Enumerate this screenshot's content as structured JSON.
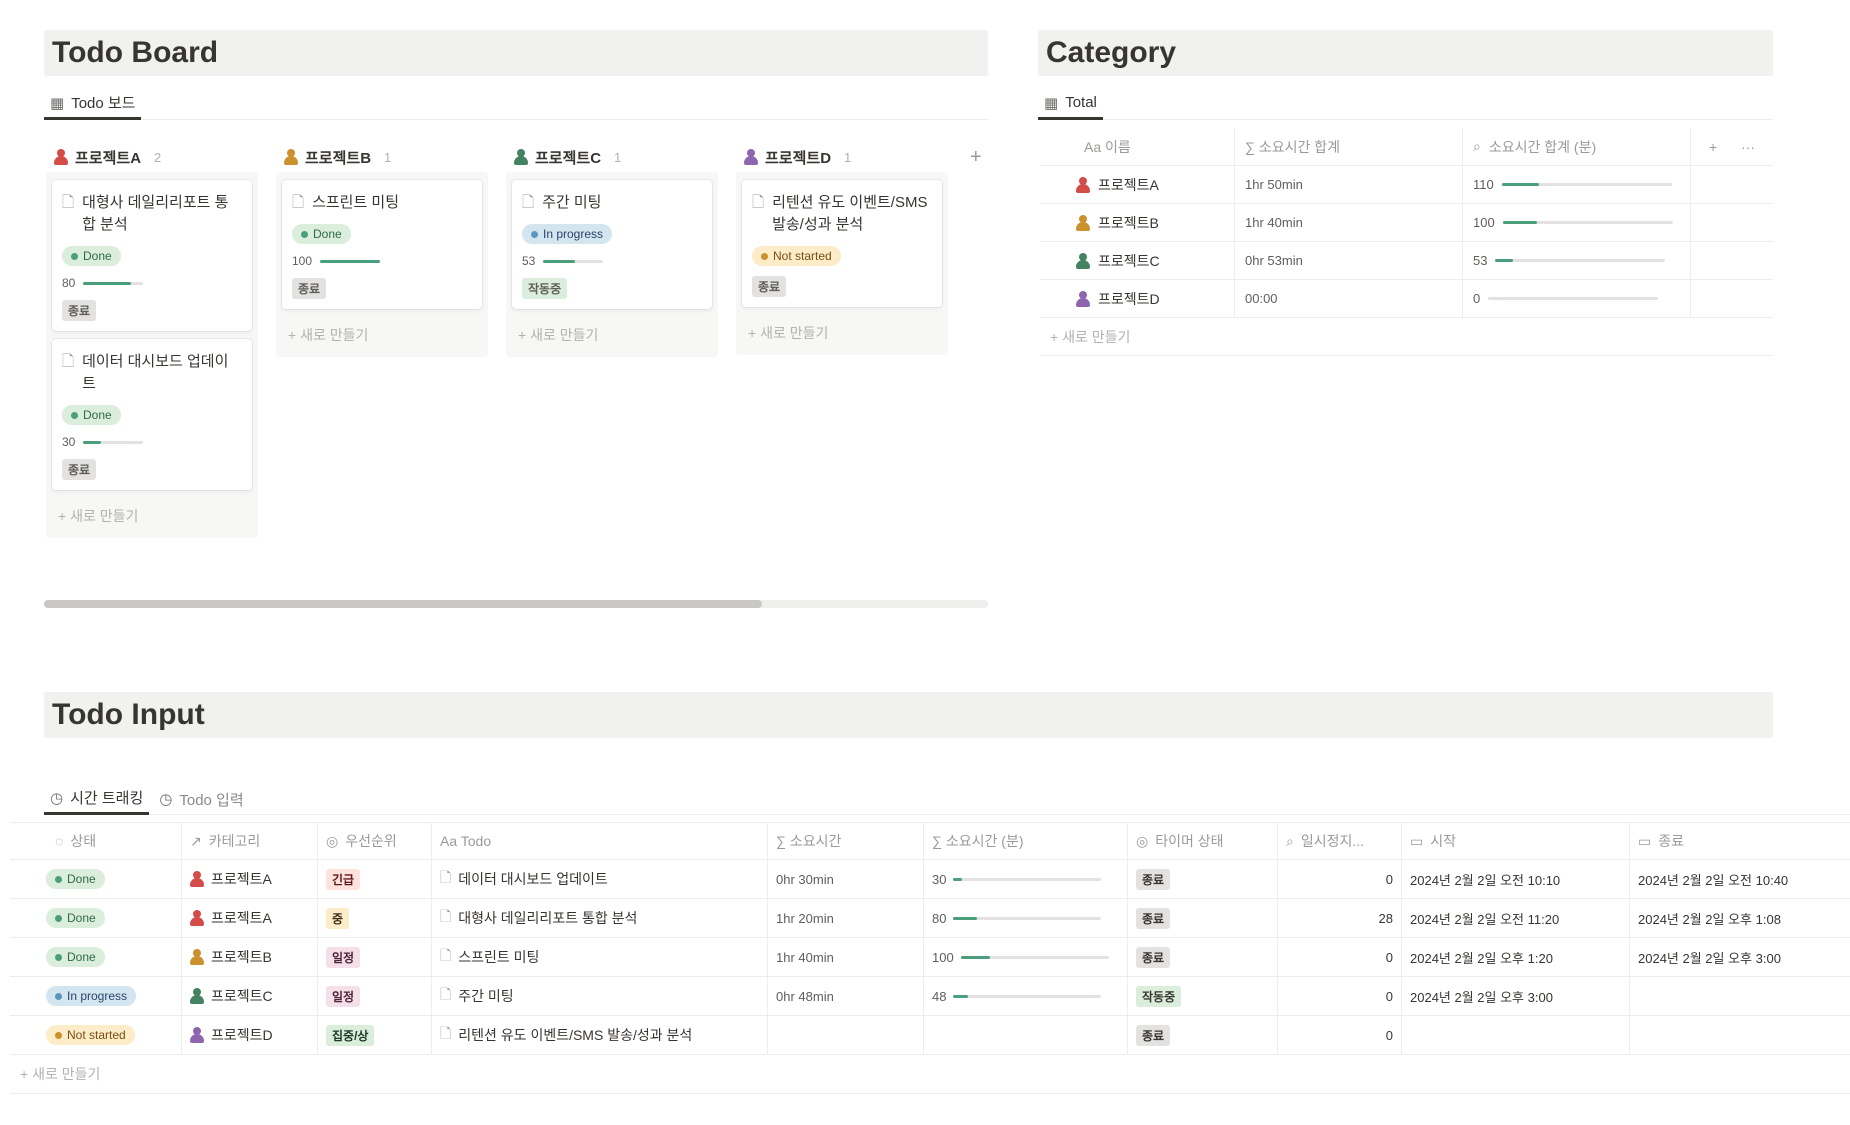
{
  "colors": {
    "project_a": "#d44c47",
    "project_b": "#cb912f",
    "project_c": "#448361",
    "project_d": "#9065b0",
    "progress_fill": "#4a9e7b"
  },
  "todo_board": {
    "title": "Todo Board",
    "tab": "Todo 보드",
    "columns": [
      {
        "name": "프로젝트A",
        "count": "2",
        "color": "#d44c47",
        "cards": [
          {
            "title": "대형사 데일리리포트 통합 분석",
            "status": "Done",
            "status_bg": "#dbeddb",
            "status_fg": "#2e6b48",
            "status_dot": "#4a9e7b",
            "progress_label": "80",
            "progress": 0.8,
            "pill": "종료",
            "pill_bg": "#e3e2e0"
          },
          {
            "title": "데이터 대시보드 업데이트",
            "status": "Done",
            "status_bg": "#dbeddb",
            "status_fg": "#2e6b48",
            "status_dot": "#4a9e7b",
            "progress_label": "30",
            "progress": 0.3,
            "pill": "종료",
            "pill_bg": "#e3e2e0"
          }
        ],
        "new": "+ 새로 만들기"
      },
      {
        "name": "프로젝트B",
        "count": "1",
        "color": "#cb912f",
        "cards": [
          {
            "title": "스프린트 미팅",
            "status": "Done",
            "status_bg": "#dbeddb",
            "status_fg": "#2e6b48",
            "status_dot": "#4a9e7b",
            "progress_label": "100",
            "progress": 1.0,
            "pill": "종료",
            "pill_bg": "#e3e2e0"
          }
        ],
        "new": "+ 새로 만들기"
      },
      {
        "name": "프로젝트C",
        "count": "1",
        "color": "#448361",
        "cards": [
          {
            "title": "주간 미팅",
            "status": "In progress",
            "status_bg": "#d3e5ef",
            "status_fg": "#28456c",
            "status_dot": "#5b97bd",
            "progress_label": "53",
            "progress": 0.53,
            "pill": "작동중",
            "pill_bg": "#dbeddb"
          }
        ],
        "new": "+ 새로 만들기"
      },
      {
        "name": "프로젝트D",
        "count": "1",
        "color": "#9065b0",
        "cards": [
          {
            "title": "리텐션 유도 이벤트/SMS 발송/성과 분석",
            "status": "Not started",
            "status_bg": "#fdecc8",
            "status_fg": "#7a4e12",
            "status_dot": "#cb912f",
            "progress_label": "",
            "progress": null,
            "pill": "종료",
            "pill_bg": "#e3e2e0"
          }
        ],
        "new": "+ 새로 만들기"
      }
    ],
    "add_column": "+"
  },
  "category": {
    "title": "Category",
    "tab": "Total",
    "headers": [
      "Aa 이름",
      "∑ 소요시간 합계",
      "소요시간 합계 (분)",
      "+",
      "···"
    ],
    "rows": [
      {
        "name": "프로젝트A",
        "color": "#d44c47",
        "total": "1hr 50min",
        "minutes": "110",
        "fill": 0.22
      },
      {
        "name": "프로젝트B",
        "color": "#cb912f",
        "total": "1hr 40min",
        "minutes": "100",
        "fill": 0.2
      },
      {
        "name": "프로젝트C",
        "color": "#448361",
        "total": "0hr 53min",
        "minutes": "53",
        "fill": 0.106
      },
      {
        "name": "프로젝트D",
        "color": "#9065b0",
        "total": "00:00",
        "minutes": "0",
        "fill": 0
      }
    ],
    "new": "+ 새로 만들기"
  },
  "todo_input": {
    "title": "Todo Input",
    "tabs": [
      "시간 트래킹",
      "Todo 입력"
    ],
    "headers": [
      "상태",
      "카테고리",
      "우선순위",
      "Aa Todo",
      "∑ 소요시간",
      "∑ 소요시간 (분)",
      "타이머 상태",
      "일시정지...",
      "시작",
      "종료"
    ],
    "rows": [
      {
        "status": "Done",
        "status_bg": "#dbeddb",
        "status_fg": "#2e6b48",
        "status_dot": "#4a9e7b",
        "category": "프로젝트A",
        "cat_color": "#d44c47",
        "priority": "긴급",
        "priority_bg": "#ffe2dd",
        "priority_fg": "#5d1715",
        "todo": "데이터 대시보드 업데이트",
        "time": "0hr 30min",
        "minutes": "30",
        "fill": 0.06,
        "timer": "종료",
        "timer_bg": "#e3e2e0",
        "pause": "0",
        "start": "2024년 2월 2일 오전 10:10",
        "end": "2024년 2월 2일 오전 10:40"
      },
      {
        "status": "Done",
        "status_bg": "#dbeddb",
        "status_fg": "#2e6b48",
        "status_dot": "#4a9e7b",
        "category": "프로젝트A",
        "cat_color": "#d44c47",
        "priority": "중",
        "priority_bg": "#fdecc8",
        "priority_fg": "#402c1b",
        "todo": "대형사 데일리리포트 통합 분석",
        "time": "1hr 20min",
        "minutes": "80",
        "fill": 0.16,
        "timer": "종료",
        "timer_bg": "#e3e2e0",
        "pause": "28",
        "start": "2024년 2월 2일 오전 11:20",
        "end": "2024년 2월 2일 오후 1:08"
      },
      {
        "status": "Done",
        "status_bg": "#dbeddb",
        "status_fg": "#2e6b48",
        "status_dot": "#4a9e7b",
        "category": "프로젝트B",
        "cat_color": "#cb912f",
        "priority": "일정",
        "priority_bg": "#f5e0e9",
        "priority_fg": "#4c2337",
        "todo": "스프린트 미팅",
        "time": "1hr 40min",
        "minutes": "100",
        "fill": 0.2,
        "timer": "종료",
        "timer_bg": "#e3e2e0",
        "pause": "0",
        "start": "2024년 2월 2일 오후 1:20",
        "end": "2024년 2월 2일 오후 3:00"
      },
      {
        "status": "In progress",
        "status_bg": "#d3e5ef",
        "status_fg": "#28456c",
        "status_dot": "#5b97bd",
        "category": "프로젝트C",
        "cat_color": "#448361",
        "priority": "일정",
        "priority_bg": "#f5e0e9",
        "priority_fg": "#4c2337",
        "todo": "주간 미팅",
        "time": "0hr 48min",
        "minutes": "48",
        "fill": 0.096,
        "timer": "작동중",
        "timer_bg": "#dbeddb",
        "pause": "0",
        "start": "2024년 2월 2일 오후 3:00",
        "end": ""
      },
      {
        "status": "Not started",
        "status_bg": "#fdecc8",
        "status_fg": "#7a4e12",
        "status_dot": "#cb912f",
        "category": "프로젝트D",
        "cat_color": "#9065b0",
        "priority": "집중/상",
        "priority_bg": "#dbeddb",
        "priority_fg": "#1c3829",
        "todo": "리텐션 유도 이벤트/SMS 발송/성과 분석",
        "time": "",
        "minutes": "",
        "fill": null,
        "timer": "종료",
        "timer_bg": "#e3e2e0",
        "pause": "0",
        "start": "",
        "end": ""
      }
    ],
    "new": "+ 새로 만들기"
  }
}
